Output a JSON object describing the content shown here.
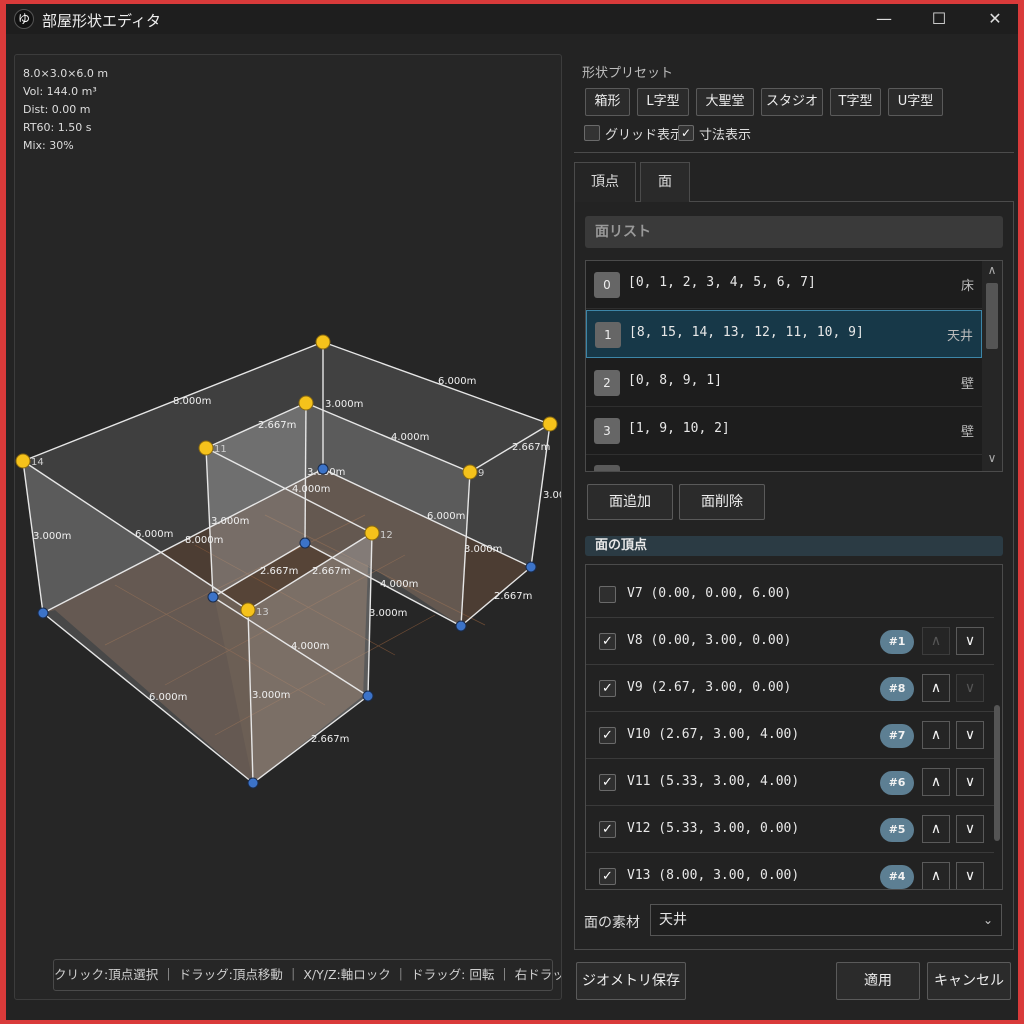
{
  "window": {
    "title": "部屋形状エディタ",
    "icon_glyph": "ゆ",
    "minimize": "—",
    "maximize": "☐",
    "close": "✕"
  },
  "viewport": {
    "info": [
      "8.0×3.0×6.0 m",
      "Vol: 144.0 m³",
      "Dist: 0.00 m",
      "RT60: 1.50 s",
      "Mix: 30%"
    ],
    "hint": "クリック:頂点選択 ｜ ドラッグ:頂点移動 ｜ X/Y/Z:軸ロック ｜ ドラッグ: 回転 ｜ 右ドラッグ: 移動",
    "vertex_labels": {
      "v9": "9",
      "v11": "11",
      "v12": "12",
      "v13": "13",
      "v14": "14"
    },
    "dimensions": [
      "8.000m",
      "6.000m",
      "2.667m",
      "3.000m",
      "4.000m",
      "2.667m",
      "3.000m",
      "3.000m",
      "4.000m",
      "3.000m",
      "3.000m",
      "6.000m",
      "8.000m",
      "6.000m",
      "2.667m",
      "2.667m",
      "4.000m",
      "3.000m",
      "2.667m",
      "3.000m",
      "4.000m",
      "3.000m",
      "6.000m",
      "2.667m"
    ]
  },
  "presets": {
    "label": "形状プリセット",
    "buttons": [
      "箱形",
      "L字型",
      "大聖堂",
      "スタジオ",
      "T字型",
      "U字型"
    ],
    "grid_label": "グリッド表示",
    "grid_checked": false,
    "dims_label": "寸法表示",
    "dims_checked": true
  },
  "tabs": [
    "頂点",
    "面"
  ],
  "active_tab": "面",
  "face_list": {
    "header": "面リスト",
    "rows": [
      {
        "index": "0",
        "vertices": "[0, 1, 2, 3, 4, 5, 6, 7]",
        "type": "床"
      },
      {
        "index": "1",
        "vertices": "[8, 15, 14, 13, 12, 11, 10, 9]",
        "type": "天井"
      },
      {
        "index": "2",
        "vertices": "[0, 8, 9, 1]",
        "type": "壁"
      },
      {
        "index": "3",
        "vertices": "[1, 9, 10, 2]",
        "type": "壁"
      }
    ],
    "add_button": "面追加",
    "delete_button": "面削除"
  },
  "face_vertices": {
    "header": "面の頂点",
    "rows": [
      {
        "label": "V7  (0.00, 0.00, 6.00)",
        "checked": false,
        "badge": ""
      },
      {
        "label": "V8  (0.00, 3.00, 0.00)",
        "checked": true,
        "badge": "#1"
      },
      {
        "label": "V9  (2.67, 3.00, 0.00)",
        "checked": true,
        "badge": "#8"
      },
      {
        "label": "V10  (2.67, 3.00, 4.00)",
        "checked": true,
        "badge": "#7"
      },
      {
        "label": "V11  (5.33, 3.00, 4.00)",
        "checked": true,
        "badge": "#6"
      },
      {
        "label": "V12  (5.33, 3.00, 0.00)",
        "checked": true,
        "badge": "#5"
      },
      {
        "label": "V13  (8.00, 3.00, 0.00)",
        "checked": true,
        "badge": "#4"
      }
    ],
    "up_glyph": "∧",
    "down_glyph": "∨",
    "check_glyph": "✓"
  },
  "material": {
    "label": "面の素材",
    "value": "天井",
    "arrow": "⌄"
  },
  "footer": {
    "save_geometry": "ジオメトリ保存",
    "apply": "適用",
    "cancel": "キャンセル"
  },
  "colors": {
    "top_vertex": "#f5c21b",
    "bottom_vertex": "#3c73c8",
    "floor": "#5a4638",
    "selection": "#173848"
  }
}
